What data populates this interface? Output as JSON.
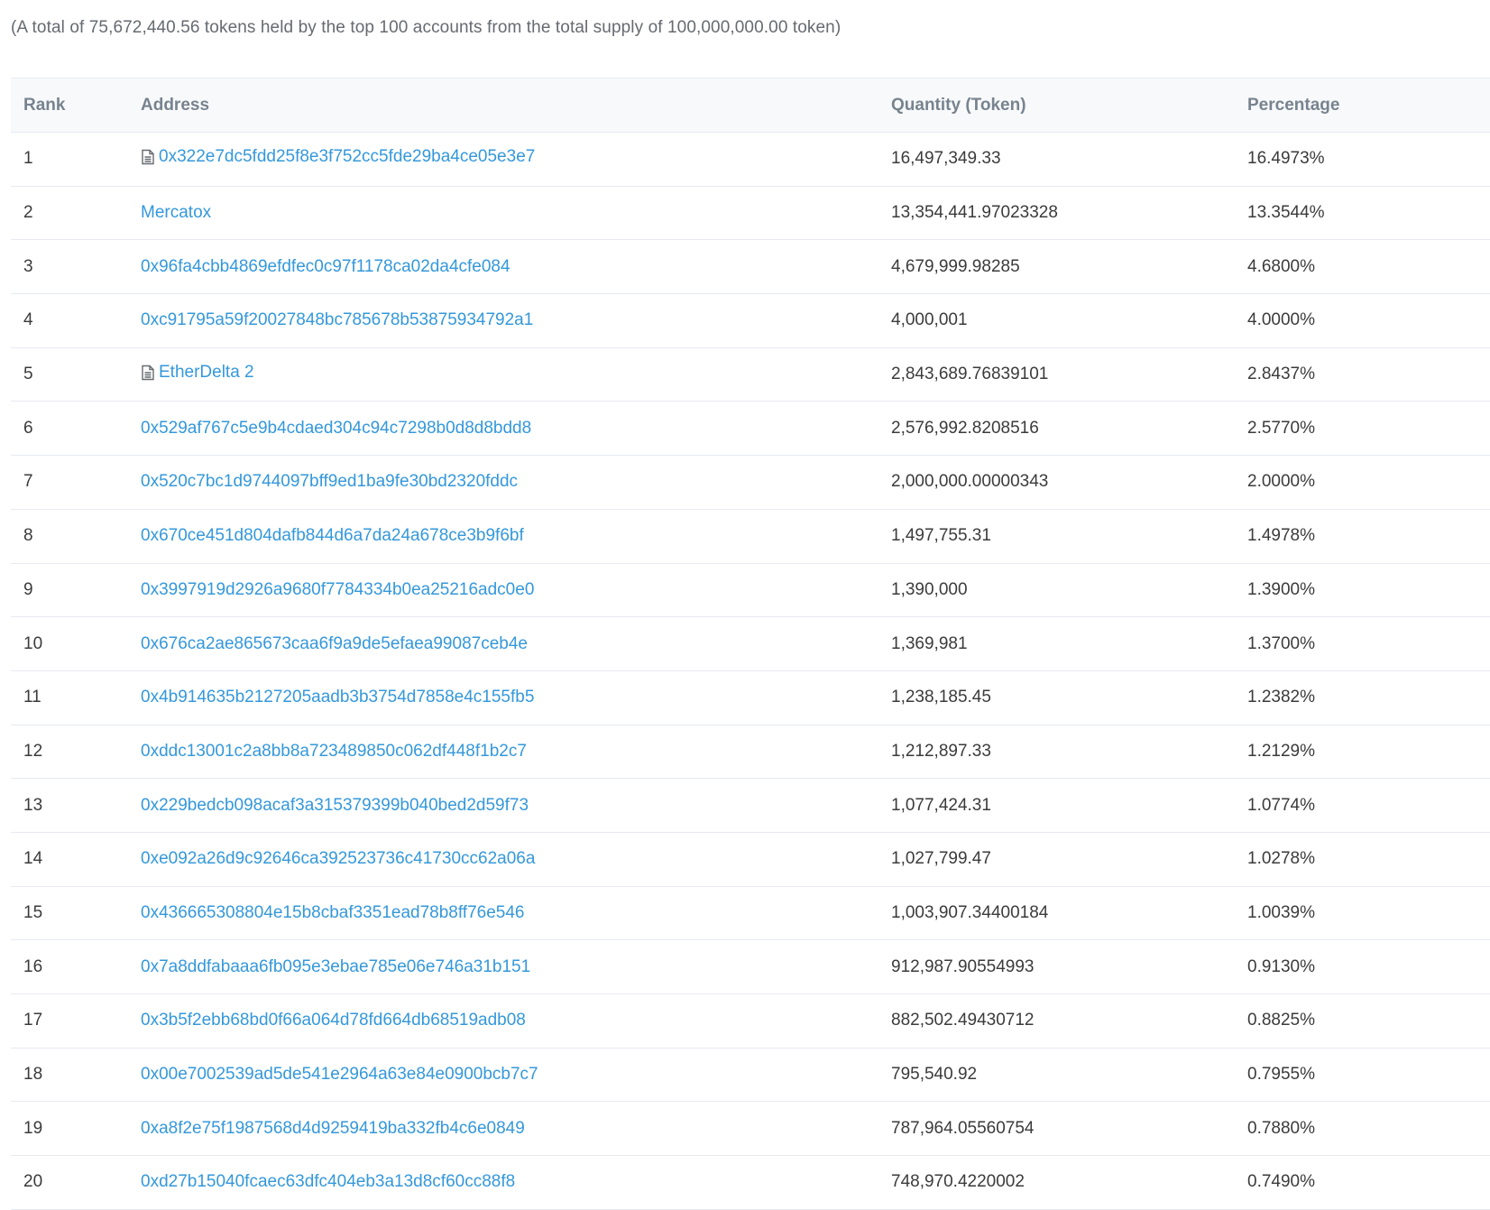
{
  "summary": "(A total of 75,672,440.56 tokens held by the top 100 accounts from the total supply of 100,000,000.00 token)",
  "table": {
    "headers": {
      "rank": "Rank",
      "address": "Address",
      "quantity": "Quantity (Token)",
      "percentage": "Percentage"
    },
    "rows": [
      {
        "rank": "1",
        "address": "0x322e7dc5fdd25f8e3f752cc5fde29ba4ce05e3e7",
        "contract_icon": "document-icon",
        "quantity": "16,497,349.33",
        "percentage": "16.4973%"
      },
      {
        "rank": "2",
        "address": "Mercatox",
        "contract_icon": null,
        "quantity": "13,354,441.97023328",
        "percentage": "13.3544%"
      },
      {
        "rank": "3",
        "address": "0x96fa4cbb4869efdfec0c97f1178ca02da4cfe084",
        "contract_icon": null,
        "quantity": "4,679,999.98285",
        "percentage": "4.6800%"
      },
      {
        "rank": "4",
        "address": "0xc91795a59f20027848bc785678b53875934792a1",
        "contract_icon": null,
        "quantity": "4,000,001",
        "percentage": "4.0000%"
      },
      {
        "rank": "5",
        "address": "EtherDelta 2",
        "contract_icon": "document-icon",
        "quantity": "2,843,689.76839101",
        "percentage": "2.8437%"
      },
      {
        "rank": "6",
        "address": "0x529af767c5e9b4cdaed304c94c7298b0d8d8bdd8",
        "contract_icon": null,
        "quantity": "2,576,992.8208516",
        "percentage": "2.5770%"
      },
      {
        "rank": "7",
        "address": "0x520c7bc1d9744097bff9ed1ba9fe30bd2320fddc",
        "contract_icon": null,
        "quantity": "2,000,000.00000343",
        "percentage": "2.0000%"
      },
      {
        "rank": "8",
        "address": "0x670ce451d804dafb844d6a7da24a678ce3b9f6bf",
        "contract_icon": null,
        "quantity": "1,497,755.31",
        "percentage": "1.4978%"
      },
      {
        "rank": "9",
        "address": "0x3997919d2926a9680f7784334b0ea25216adc0e0",
        "contract_icon": null,
        "quantity": "1,390,000",
        "percentage": "1.3900%"
      },
      {
        "rank": "10",
        "address": "0x676ca2ae865673caa6f9a9de5efaea99087ceb4e",
        "contract_icon": null,
        "quantity": "1,369,981",
        "percentage": "1.3700%"
      },
      {
        "rank": "11",
        "address": "0x4b914635b2127205aadb3b3754d7858e4c155fb5",
        "contract_icon": null,
        "quantity": "1,238,185.45",
        "percentage": "1.2382%"
      },
      {
        "rank": "12",
        "address": "0xddc13001c2a8bb8a723489850c062df448f1b2c7",
        "contract_icon": null,
        "quantity": "1,212,897.33",
        "percentage": "1.2129%"
      },
      {
        "rank": "13",
        "address": "0x229bedcb098acaf3a315379399b040bed2d59f73",
        "contract_icon": null,
        "quantity": "1,077,424.31",
        "percentage": "1.0774%"
      },
      {
        "rank": "14",
        "address": "0xe092a26d9c92646ca392523736c41730cc62a06a",
        "contract_icon": null,
        "quantity": "1,027,799.47",
        "percentage": "1.0278%"
      },
      {
        "rank": "15",
        "address": "0x436665308804e15b8cbaf3351ead78b8ff76e546",
        "contract_icon": null,
        "quantity": "1,003,907.34400184",
        "percentage": "1.0039%"
      },
      {
        "rank": "16",
        "address": "0x7a8ddfabaaa6fb095e3ebae785e06e746a31b151",
        "contract_icon": null,
        "quantity": "912,987.90554993",
        "percentage": "0.9130%"
      },
      {
        "rank": "17",
        "address": "0x3b5f2ebb68bd0f66a064d78fd664db68519adb08",
        "contract_icon": null,
        "quantity": "882,502.49430712",
        "percentage": "0.8825%"
      },
      {
        "rank": "18",
        "address": "0x00e7002539ad5de541e2964a63e84e0900bcb7c7",
        "contract_icon": null,
        "quantity": "795,540.92",
        "percentage": "0.7955%"
      },
      {
        "rank": "19",
        "address": "0xa8f2e75f1987568d4d9259419ba332fb4c6e0849",
        "contract_icon": null,
        "quantity": "787,964.05560754",
        "percentage": "0.7880%"
      },
      {
        "rank": "20",
        "address": "0xd27b15040fcaec63dfc404eb3a13d8cf60cc88f8",
        "contract_icon": null,
        "quantity": "748,970.4220002",
        "percentage": "0.7490%"
      }
    ]
  },
  "colors": {
    "link": "#3498db",
    "header_text": "#77838f",
    "header_bg": "#f8f9fa",
    "border": "#e7eaf3",
    "body_text": "#3b3b3b"
  }
}
